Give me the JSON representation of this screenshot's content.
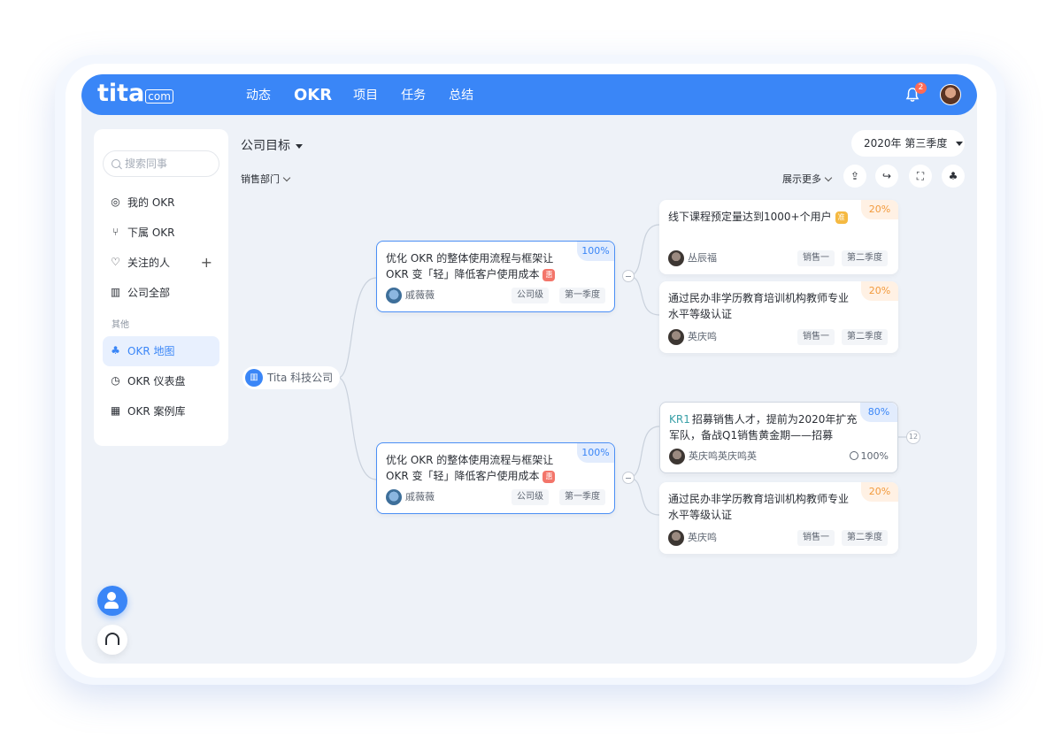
{
  "header": {
    "logo": "tita",
    "logo_suffix": "com",
    "nav": [
      "动态",
      "OKR",
      "项目",
      "任务",
      "总结"
    ],
    "notification_count": "2"
  },
  "sidebar": {
    "search_placeholder": "搜索同事",
    "items": [
      {
        "label": "我的 OKR",
        "icon": "target-icon"
      },
      {
        "label": "下属 OKR",
        "icon": "branch-icon"
      },
      {
        "label": "关注的人",
        "icon": "heart-icon"
      },
      {
        "label": "公司全部",
        "icon": "building-icon"
      }
    ],
    "section_label": "其他",
    "other_items": [
      {
        "label": "OKR 地图",
        "icon": "org-chart-icon",
        "active": true
      },
      {
        "label": "OKR 仪表盘",
        "icon": "dashboard-icon"
      },
      {
        "label": "OKR 案例库",
        "icon": "grid-icon"
      }
    ]
  },
  "main": {
    "title": "公司目标",
    "quarter": "2020年 第三季度",
    "department": "销售部门",
    "show_more": "展示更多",
    "root_node": "Tita 科技公司"
  },
  "objectives": [
    {
      "text": "优化 OKR 的整体使用流程与框架让 OKR 变「轻」降低客户使用成本",
      "badge": "惠",
      "progress": "100%",
      "owner": "戚薇薇",
      "level": "公司级",
      "quarter": "第一季度"
    },
    {
      "text": "优化 OKR 的整体使用流程与框架让 OKR 变「轻」降低客户使用成本",
      "badge": "惠",
      "progress": "100%",
      "owner": "戚薇薇",
      "level": "公司级",
      "quarter": "第一季度"
    }
  ],
  "key_results": [
    {
      "text": "线下课程预定量达到1000+个用户",
      "badge": "准",
      "progress": "20%",
      "owner": "丛辰福",
      "dept": "销售一",
      "quarter": "第二季度"
    },
    {
      "text": "通过民办非学历教育培训机构教师专业水平等级认证",
      "progress": "20%",
      "owner": "英庆鸣",
      "dept": "销售一",
      "quarter": "第二季度"
    },
    {
      "label": "KR1",
      "text": "招募销售人才，提前为2020年扩充军队，备战Q1销售黄金期——招募",
      "progress": "80%",
      "owner": "英庆鸣英庆鸣英",
      "completion": "100%",
      "child_count": "12"
    },
    {
      "text": "通过民办非学历教育培训机构教师专业水平等级认证",
      "progress": "20%",
      "owner": "英庆鸣",
      "dept": "销售一",
      "quarter": "第二季度"
    }
  ],
  "colors": {
    "accent": "#3a86f7",
    "progress_orange": "#f29a3c",
    "background": "#eef2f8"
  }
}
